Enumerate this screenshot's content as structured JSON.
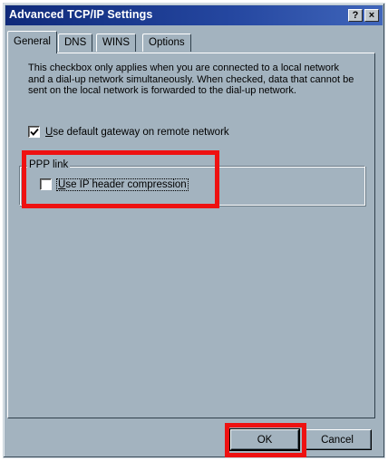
{
  "window": {
    "title": "Advanced TCP/IP Settings",
    "help_label": "?",
    "close_label": "×"
  },
  "tabs": [
    {
      "label": "General",
      "active": true
    },
    {
      "label": "DNS",
      "active": false
    },
    {
      "label": "WINS",
      "active": false
    },
    {
      "label": "Options",
      "active": false
    }
  ],
  "general": {
    "description": "This checkbox only applies when you are connected to a local network and a dial-up network simultaneously.  When checked, data that cannot be sent on the local network is forwarded to the dial-up network.",
    "default_gateway": {
      "label_u": "U",
      "label_rest": "se default gateway on remote network",
      "checked": true
    },
    "ppp_group": {
      "label": "PPP link",
      "ip_header": {
        "label_u": "U",
        "label_rest": "se IP header compression",
        "checked": false
      }
    }
  },
  "buttons": {
    "ok_label": "OK",
    "cancel_label": "Cancel"
  },
  "colors": {
    "highlight": "#ee1111",
    "dialog_face": "#a3b3bf",
    "titlebar": "#0f2a7a"
  }
}
